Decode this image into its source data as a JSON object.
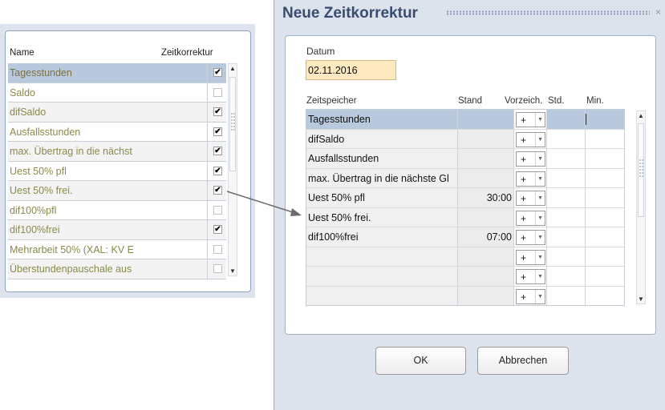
{
  "left_panel": {
    "col_name": "Name",
    "col_zeitkorrektur": "Zeitkorrektur",
    "rows": [
      {
        "label": "Tagesstunden",
        "checked": true,
        "selected": true
      },
      {
        "label": "Saldo",
        "checked": false
      },
      {
        "label": "difSaldo",
        "checked": true
      },
      {
        "label": "Ausfallsstunden",
        "checked": true
      },
      {
        "label": "max. Übertrag in die nächst",
        "checked": true
      },
      {
        "label": "Uest 50% pfl",
        "checked": true
      },
      {
        "label": "Uest 50% frei.",
        "checked": true
      },
      {
        "label": "dif100%pfl",
        "checked": false
      },
      {
        "label": "dif100%frei",
        "checked": true
      },
      {
        "label": "Mehrarbeit 50% (XAL: KV E",
        "checked": false
      },
      {
        "label": "Überstundenpauschale aus",
        "checked": false
      }
    ],
    "check_glyph": "✔"
  },
  "dialog": {
    "title": "Neue Zeitkorrektur",
    "close_icon": "×",
    "datum_label": "Datum",
    "datum_value": "02.11.2016",
    "grid_headers": {
      "zeitspeicher": "Zeitspeicher",
      "stand": "Stand",
      "vorzeich": "Vorzeich.",
      "std": "Std.",
      "min": "Min."
    },
    "grid_rows": [
      {
        "name": "Tagesstunden",
        "stand": "",
        "sign": "+"
      },
      {
        "name": "difSaldo",
        "stand": "",
        "sign": "+"
      },
      {
        "name": "Ausfallsstunden",
        "stand": "",
        "sign": "+"
      },
      {
        "name": "max. Übertrag in die nächste Gl",
        "stand": "",
        "sign": "+"
      },
      {
        "name": "Uest 50% pfl",
        "stand": "30:00",
        "sign": "+"
      },
      {
        "name": "Uest 50% frei.",
        "stand": "",
        "sign": "+"
      },
      {
        "name": "dif100%frei",
        "stand": "07:00",
        "sign": "+"
      },
      {
        "name": "",
        "stand": "",
        "sign": "+"
      },
      {
        "name": "",
        "stand": "",
        "sign": "+"
      },
      {
        "name": "",
        "stand": "",
        "sign": "+"
      }
    ],
    "ok_label": "OK",
    "cancel_label": "Abbrechen"
  },
  "icons": {
    "dropdown": "▼",
    "scroll_up": "▲",
    "scroll_down": "▼"
  }
}
